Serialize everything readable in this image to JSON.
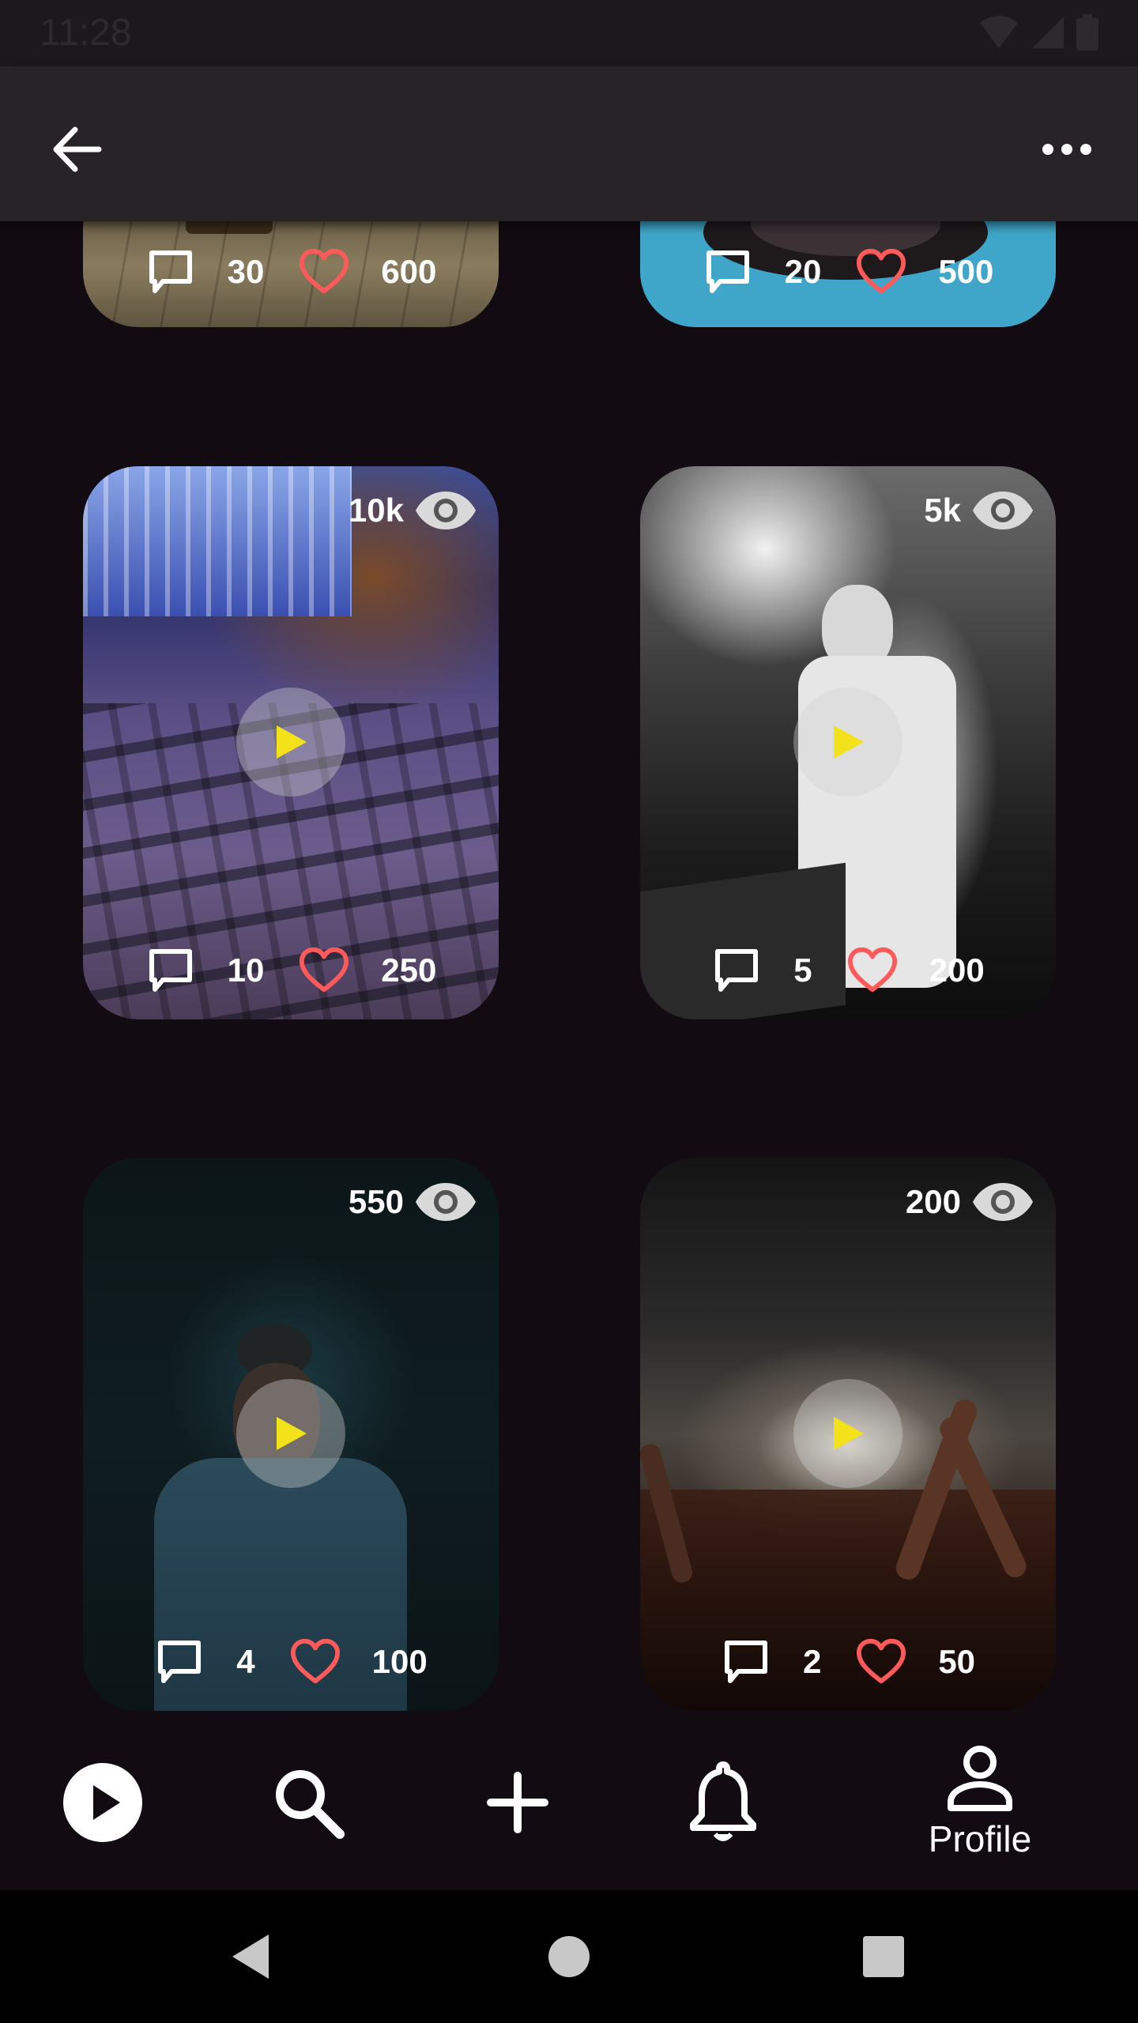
{
  "status": {
    "time": "11:28"
  },
  "app_bar": {
    "back_icon": "arrow-left-icon",
    "more_icon": "more-horizontal-icon"
  },
  "top_cards": [
    {
      "comments": "30",
      "likes": "600"
    },
    {
      "comments": "20",
      "likes": "500"
    }
  ],
  "cards": [
    {
      "views": "10k",
      "comments": "10",
      "likes": "250"
    },
    {
      "views": "5k",
      "comments": "5",
      "likes": "200"
    },
    {
      "views": "550",
      "comments": "4",
      "likes": "100"
    },
    {
      "views": "200",
      "comments": "2",
      "likes": "50"
    }
  ],
  "bottom_nav": {
    "items": [
      {
        "icon": "play-circle-icon"
      },
      {
        "icon": "search-icon"
      },
      {
        "icon": "plus-icon"
      },
      {
        "icon": "bell-icon"
      },
      {
        "icon": "person-icon",
        "label": "Profile"
      }
    ]
  },
  "colors": {
    "accent_play": "#f3e11a",
    "heart": "#ff5a5a",
    "background": "#120b12"
  }
}
